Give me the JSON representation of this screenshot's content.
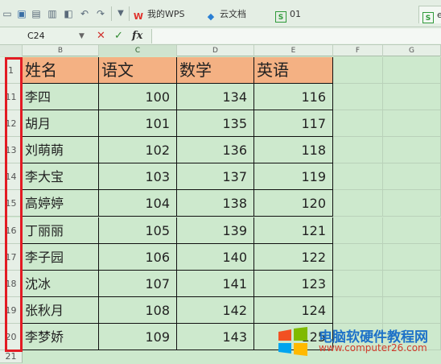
{
  "toolbar": {
    "tabs": [
      {
        "label": "我的WPS",
        "icon": "wps-logo-icon"
      },
      {
        "label": "云文档",
        "icon": "cloud-doc-icon"
      },
      {
        "label": "01",
        "icon": "spreadsheet-file-icon"
      },
      {
        "label": "e",
        "icon": "spreadsheet-file-icon"
      }
    ]
  },
  "formula_bar": {
    "cell_ref": "C24",
    "fx_label": "fx"
  },
  "columns": [
    "B",
    "C",
    "D",
    "E",
    "F",
    "G"
  ],
  "selected_column": "C",
  "header_row": {
    "row_number": "1",
    "cells": [
      "姓名",
      "语文",
      "数学",
      "英语"
    ]
  },
  "rows": [
    {
      "row_number": "11",
      "name": "李四",
      "chinese": "100",
      "math": "134",
      "english": "116"
    },
    {
      "row_number": "12",
      "name": "胡月",
      "chinese": "101",
      "math": "135",
      "english": "117"
    },
    {
      "row_number": "13",
      "name": "刘萌萌",
      "chinese": "102",
      "math": "136",
      "english": "118"
    },
    {
      "row_number": "14",
      "name": "李大宝",
      "chinese": "103",
      "math": "137",
      "english": "119"
    },
    {
      "row_number": "15",
      "name": "高婷婷",
      "chinese": "104",
      "math": "138",
      "english": "120"
    },
    {
      "row_number": "16",
      "name": "丁丽丽",
      "chinese": "105",
      "math": "139",
      "english": "121"
    },
    {
      "row_number": "17",
      "name": "李子园",
      "chinese": "106",
      "math": "140",
      "english": "122"
    },
    {
      "row_number": "18",
      "name": "沈冰",
      "chinese": "107",
      "math": "141",
      "english": "123"
    },
    {
      "row_number": "19",
      "name": "张秋月",
      "chinese": "108",
      "math": "142",
      "english": "124"
    },
    {
      "row_number": "20",
      "name": "李梦娇",
      "chinese": "109",
      "math": "143",
      "english": "125"
    }
  ],
  "trailing_row_number": "21",
  "watermark": {
    "title": "电脑软硬件教程网",
    "url": "www.computer26.com"
  },
  "colors": {
    "sheet_background": "#cde9cd",
    "header_fill": "#f4b183",
    "highlight_border": "#e21b23"
  }
}
